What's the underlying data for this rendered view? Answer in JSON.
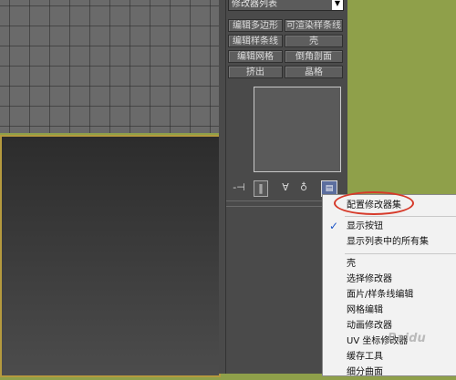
{
  "panel": {
    "modifier_list": "修改器列表",
    "dropdown_arrow": "▼",
    "buttons": [
      "编辑多边形",
      "可渲染样条线",
      "编辑样条线",
      "壳",
      "编辑网格",
      "倒角剖面",
      "挤出",
      "晶格"
    ]
  },
  "toolbar": {
    "pin_icon": "-⊣",
    "active_icon": "‖",
    "unique_icon": "∀",
    "remove_icon": "♁",
    "config_icon": "▤"
  },
  "menu": {
    "configure": "配置修改器集",
    "show_buttons": "显示按钮",
    "show_all_sets": "显示列表中的所有集",
    "check_mark": "✓",
    "sets": [
      "壳",
      "选择修改器",
      "面片/样条线编辑",
      "网格编辑",
      "动画修改器",
      "UV 坐标修改器",
      "缓存工具",
      "细分曲面"
    ]
  },
  "watermark": "Baidu"
}
